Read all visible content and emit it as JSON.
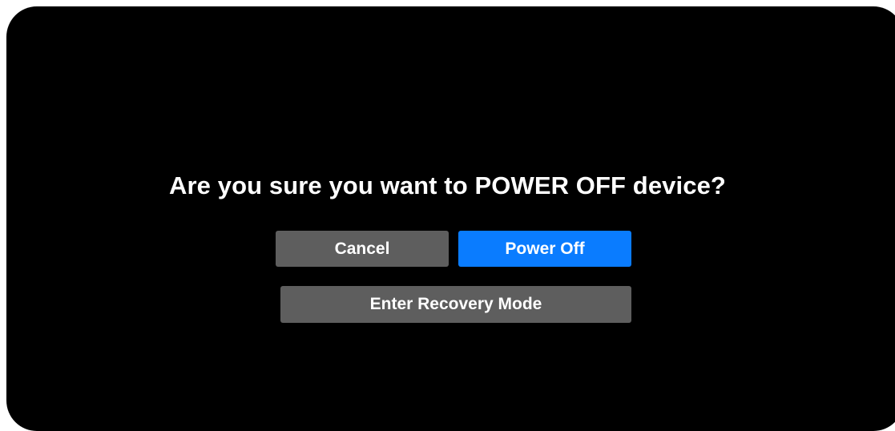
{
  "dialog": {
    "message": "Are you sure you want to POWER OFF device?",
    "cancel_label": "Cancel",
    "power_off_label": "Power Off",
    "recovery_label": "Enter Recovery Mode"
  },
  "colors": {
    "background": "#000000",
    "primary_button": "#0a7cff",
    "secondary_button": "#5e5e5e",
    "text": "#ffffff"
  }
}
